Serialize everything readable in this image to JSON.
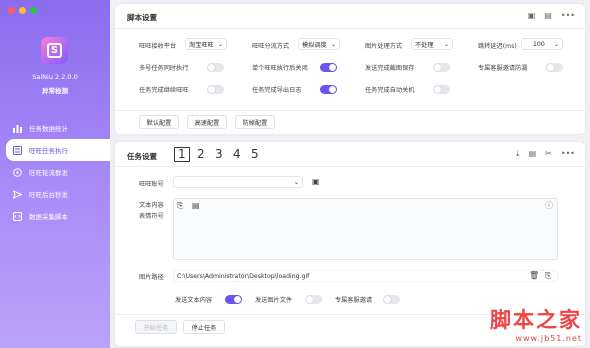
{
  "window": {
    "dots": [
      "#ff5f57",
      "#febc2e",
      "#28c840"
    ]
  },
  "app": {
    "name": "SaiNiu 2.2.0.0",
    "status": "异常检测",
    "logo_letter": "S"
  },
  "sidebar": {
    "items": [
      {
        "label": "任务数据统计",
        "icon": "bar-chart-icon"
      },
      {
        "label": "旺旺任务执行",
        "icon": "task-list-icon"
      },
      {
        "label": "旺旺轮流群发",
        "icon": "broadcast-icon"
      },
      {
        "label": "旺旺后台秒发",
        "icon": "send-icon"
      },
      {
        "label": "数据采集脚本",
        "icon": "data-script-icon"
      }
    ]
  },
  "script_settings": {
    "title": "脚本设置",
    "row1": {
      "platform_label": "旺旺接收平台",
      "platform_value": "淘宝旺旺",
      "dist_label": "旺旺分流方式",
      "dist_value": "模拟调度",
      "img_label": "图片处理方式",
      "img_value": "不处理",
      "delay_label": "跳转延迟(ms)",
      "delay_value": "100"
    },
    "toggles": [
      {
        "label": "多号任务同时执行",
        "on": false
      },
      {
        "label": "单个旺旺执行后关闭",
        "on": true
      },
      {
        "label": "发送完成截图保存",
        "on": false
      },
      {
        "label": "专属客服邀请防漏",
        "on": false
      },
      {
        "label": "任务完成继续旺旺",
        "on": false
      },
      {
        "label": "任务完成导出日志",
        "on": true
      },
      {
        "label": "任务完成自动关机",
        "on": false
      }
    ],
    "buttons": [
      "默认配置",
      "高速配置",
      "防掉配置"
    ]
  },
  "task_settings": {
    "title": "任务设置",
    "tabs": [
      "1",
      "2",
      "3",
      "4",
      "5"
    ],
    "account_label": "旺旺账号",
    "text_label1": "文本内容",
    "text_label2": "表情符号",
    "image_path_label": "图片路径",
    "image_path_value": "C:\\Users\\Administrator\\Desktop\\loading.gif",
    "send_text_label": "发送文本内容",
    "send_image_label": "发送图片文件",
    "exclusive_label": "专属客服邀请",
    "start_label": "开始任务",
    "stop_label": "停止任务"
  },
  "watermark": {
    "name": "脚本之家",
    "url": "www.jb51.net"
  },
  "colors": {
    "accent": "#6a55f0",
    "sidebar_top": "#8b6cf0",
    "sidebar_bottom": "#b9a2fa"
  }
}
